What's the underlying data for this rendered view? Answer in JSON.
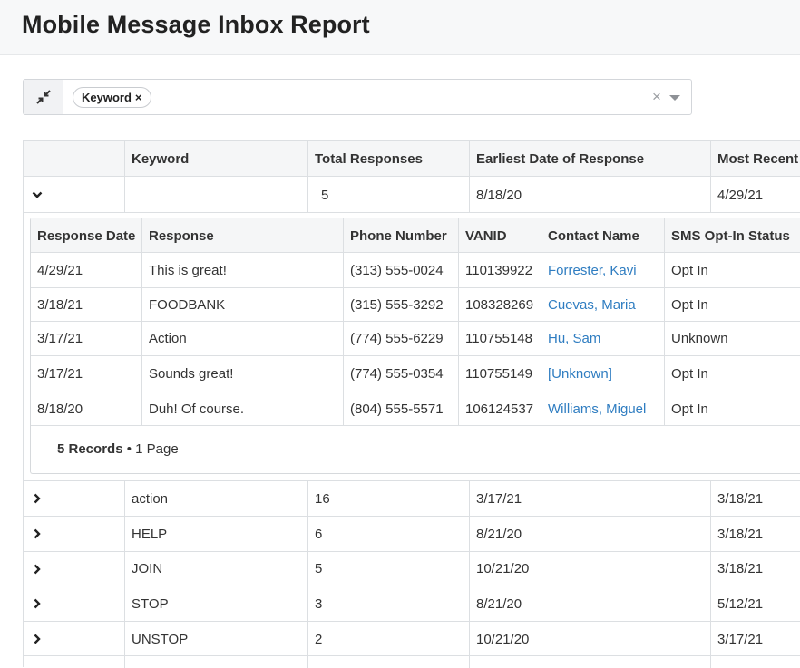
{
  "page": {
    "title": "Mobile Message Inbox Report"
  },
  "filter": {
    "chips": [
      {
        "label": "Keyword"
      }
    ],
    "chip_remove": "×",
    "clear_all": "×"
  },
  "table": {
    "columns": [
      "Keyword",
      "Total Responses",
      "Earliest Date of Response",
      "Most Recent"
    ],
    "rows": [
      {
        "expanded": true,
        "keyword": "",
        "total": "5",
        "earliest": "8/18/20",
        "recent": "4/29/21"
      },
      {
        "expanded": false,
        "keyword": "action",
        "total": "16",
        "earliest": "3/17/21",
        "recent": "3/18/21"
      },
      {
        "expanded": false,
        "keyword": "HELP",
        "total": "6",
        "earliest": "8/21/20",
        "recent": "3/18/21"
      },
      {
        "expanded": false,
        "keyword": "JOIN",
        "total": "5",
        "earliest": "10/21/20",
        "recent": "3/18/21"
      },
      {
        "expanded": false,
        "keyword": "STOP",
        "total": "3",
        "earliest": "8/21/20",
        "recent": "5/12/21"
      },
      {
        "expanded": false,
        "keyword": "UNSTOP",
        "total": "2",
        "earliest": "10/21/20",
        "recent": "3/17/21"
      }
    ]
  },
  "detail": {
    "columns": [
      "Response Date",
      "Response",
      "Phone Number",
      "VANID",
      "Contact Name",
      "SMS Opt-In Status"
    ],
    "rows": [
      {
        "date": "4/29/21",
        "response": "This is great!",
        "phone": "(313) 555-0024",
        "vanid": "110139922",
        "contact": "Forrester, Kavi",
        "status": "Opt In"
      },
      {
        "date": "3/18/21",
        "response": "FOODBANK",
        "phone": "(315) 555-3292",
        "vanid": "108328269",
        "contact": "Cuevas, Maria",
        "status": "Opt In"
      },
      {
        "date": "3/17/21",
        "response": "Action",
        "phone": "(774) 555-6229",
        "vanid": "110755148",
        "contact": "Hu, Sam",
        "status": "Unknown"
      },
      {
        "date": "3/17/21",
        "response": "Sounds great!",
        "phone": "(774) 555-0354",
        "vanid": "110755149",
        "contact": "[Unknown]",
        "status": "Opt In"
      },
      {
        "date": "8/18/20",
        "response": "Duh! Of course.",
        "phone": "(804) 555-5571",
        "vanid": "106124537",
        "contact": "Williams, Miguel",
        "status": "Opt In"
      }
    ],
    "footer": {
      "records": "5 Records",
      "separator": " • ",
      "pages": "1 Page"
    }
  },
  "colors": {
    "link": "#2f7dc1",
    "header_bg": "#f5f6f7",
    "border": "#dcdfe2"
  },
  "icons": {
    "collapse": "collapse-arrows-icon",
    "expanded": "chevron-down-icon",
    "collapsed": "chevron-right-icon",
    "clear": "clear-icon",
    "caret": "caret-down-icon"
  }
}
